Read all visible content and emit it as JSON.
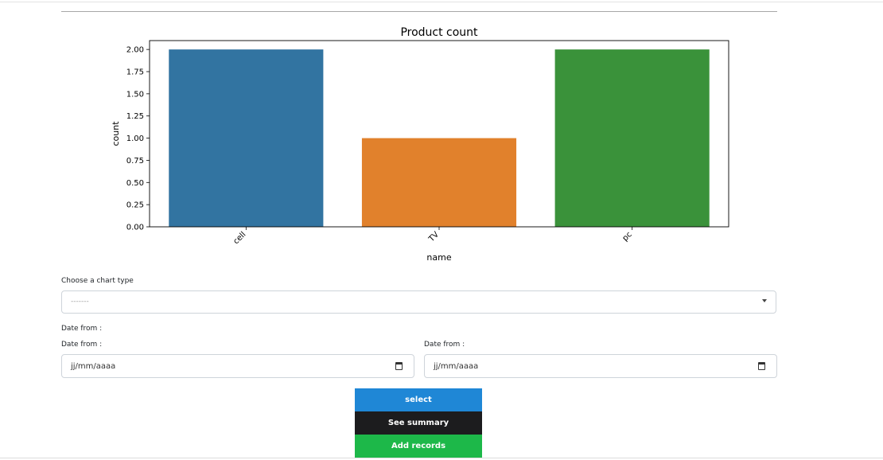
{
  "chart_data": {
    "type": "bar",
    "title": "Product count",
    "xlabel": "name",
    "ylabel": "count",
    "categories": [
      "cell",
      "TV",
      "pc"
    ],
    "values": [
      2,
      1,
      2
    ],
    "colors": [
      "#3274a1",
      "#e1812c",
      "#3a923a"
    ],
    "ylim": [
      0,
      2.1
    ],
    "yticks": [
      "0.00",
      "0.25",
      "0.50",
      "0.75",
      "1.00",
      "1.25",
      "1.50",
      "1.75",
      "2.00"
    ],
    "ytick_values": [
      0,
      0.25,
      0.5,
      0.75,
      1,
      1.25,
      1.5,
      1.75,
      2
    ],
    "grid": false,
    "xtick_rotation": 45
  },
  "form": {
    "chart_type_label": "Choose a chart type",
    "chart_type_value": "-------",
    "date_section_label": "Date from :",
    "date_from_label_1": "Date from :",
    "date_from_label_2": "Date from :",
    "date_placeholder_1": "jj/mm/aaaa",
    "date_placeholder_2": "jj/mm/aaaa",
    "calendar_icon": "calendar-icon"
  },
  "buttons": {
    "select": {
      "label": "select",
      "color": "#1f87d6"
    },
    "summary": {
      "label": "See summary",
      "color": "#1c1c1e"
    },
    "add": {
      "label": "Add records",
      "color": "#1db849"
    }
  }
}
